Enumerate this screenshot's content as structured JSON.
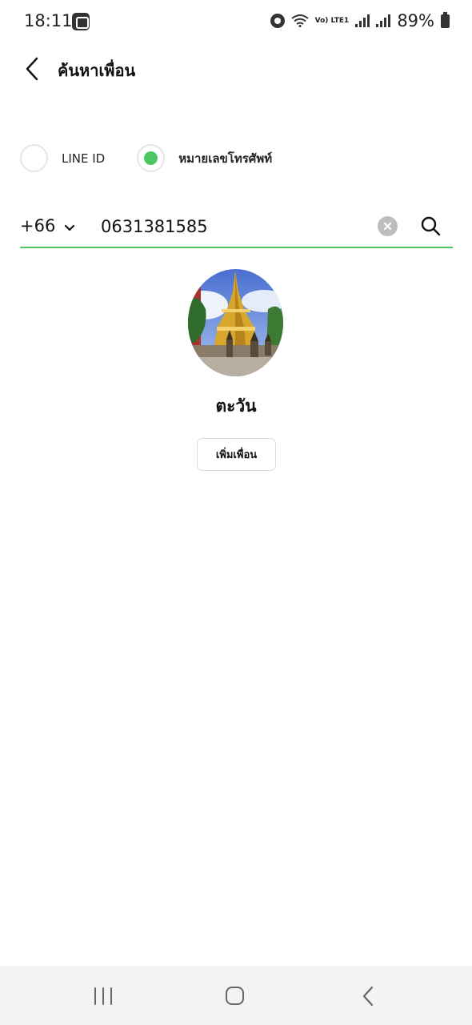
{
  "status_bar": {
    "time": "18:11",
    "lte_label": "Vo) LTE1",
    "battery": "89%"
  },
  "header": {
    "title": "ค้นหาเพื่อน"
  },
  "search_type": {
    "options": [
      {
        "label": "LINE ID",
        "selected": false
      },
      {
        "label": "หมายเลขโทรศัพท์",
        "selected": true
      }
    ]
  },
  "phone_search": {
    "country_code": "+66",
    "phone_number": "0631381585"
  },
  "result": {
    "name": "ตะวัน",
    "add_friend_label": "เพิ่มเพื่อน"
  },
  "colors": {
    "accent": "#4cc764"
  },
  "icons": {
    "back": "chevron-left-icon",
    "dropdown": "chevron-down-icon",
    "clear": "close-circle-icon",
    "search": "search-icon"
  }
}
